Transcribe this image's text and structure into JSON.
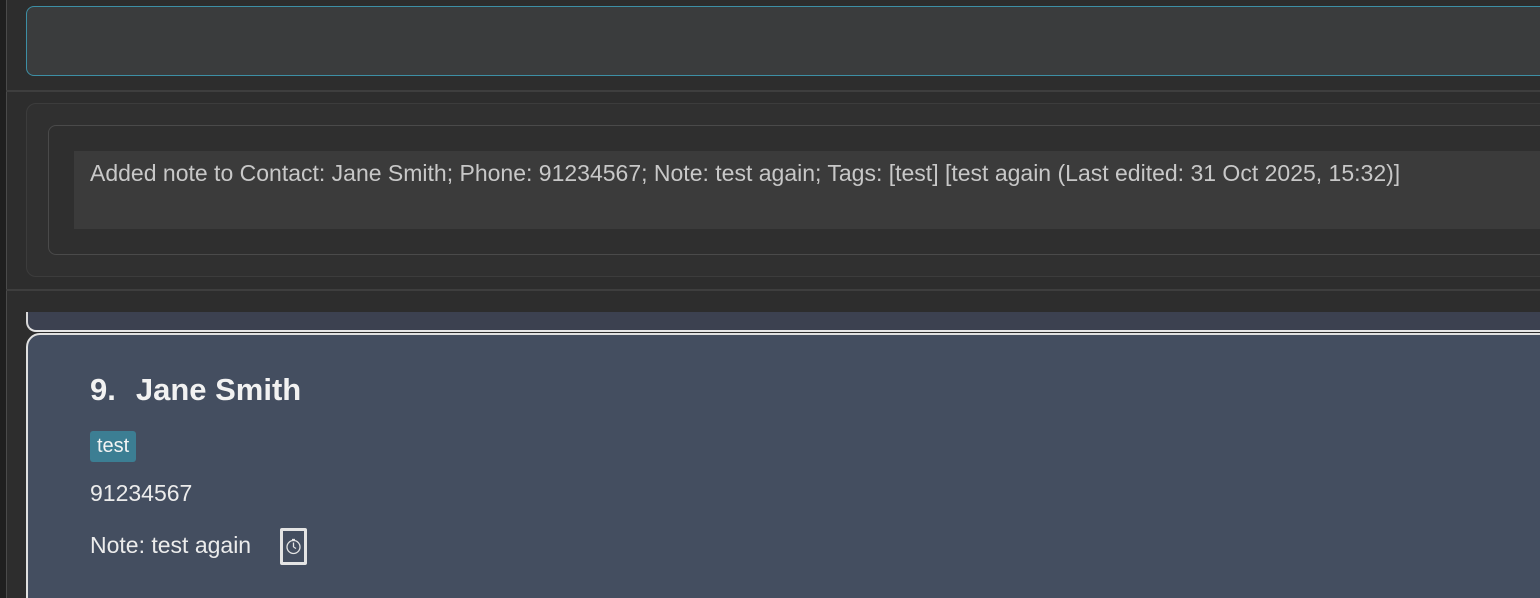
{
  "command_box": {
    "value": ""
  },
  "result_display": {
    "text": "Added note to Contact: Jane Smith; Phone: 91234567; Note: test again; Tags: [test] [test again (Last edited: 31 Oct 2025, 15:32)]"
  },
  "person_card": {
    "index": "9.",
    "name": "Jane Smith",
    "tags": [
      "test"
    ],
    "phone": "91234567",
    "note": "Note: test again",
    "note_icon": "clock-icon"
  },
  "colors": {
    "command_border": "#3d8fa5",
    "card_background": "#444e60",
    "tag_background": "#3c7e93"
  }
}
